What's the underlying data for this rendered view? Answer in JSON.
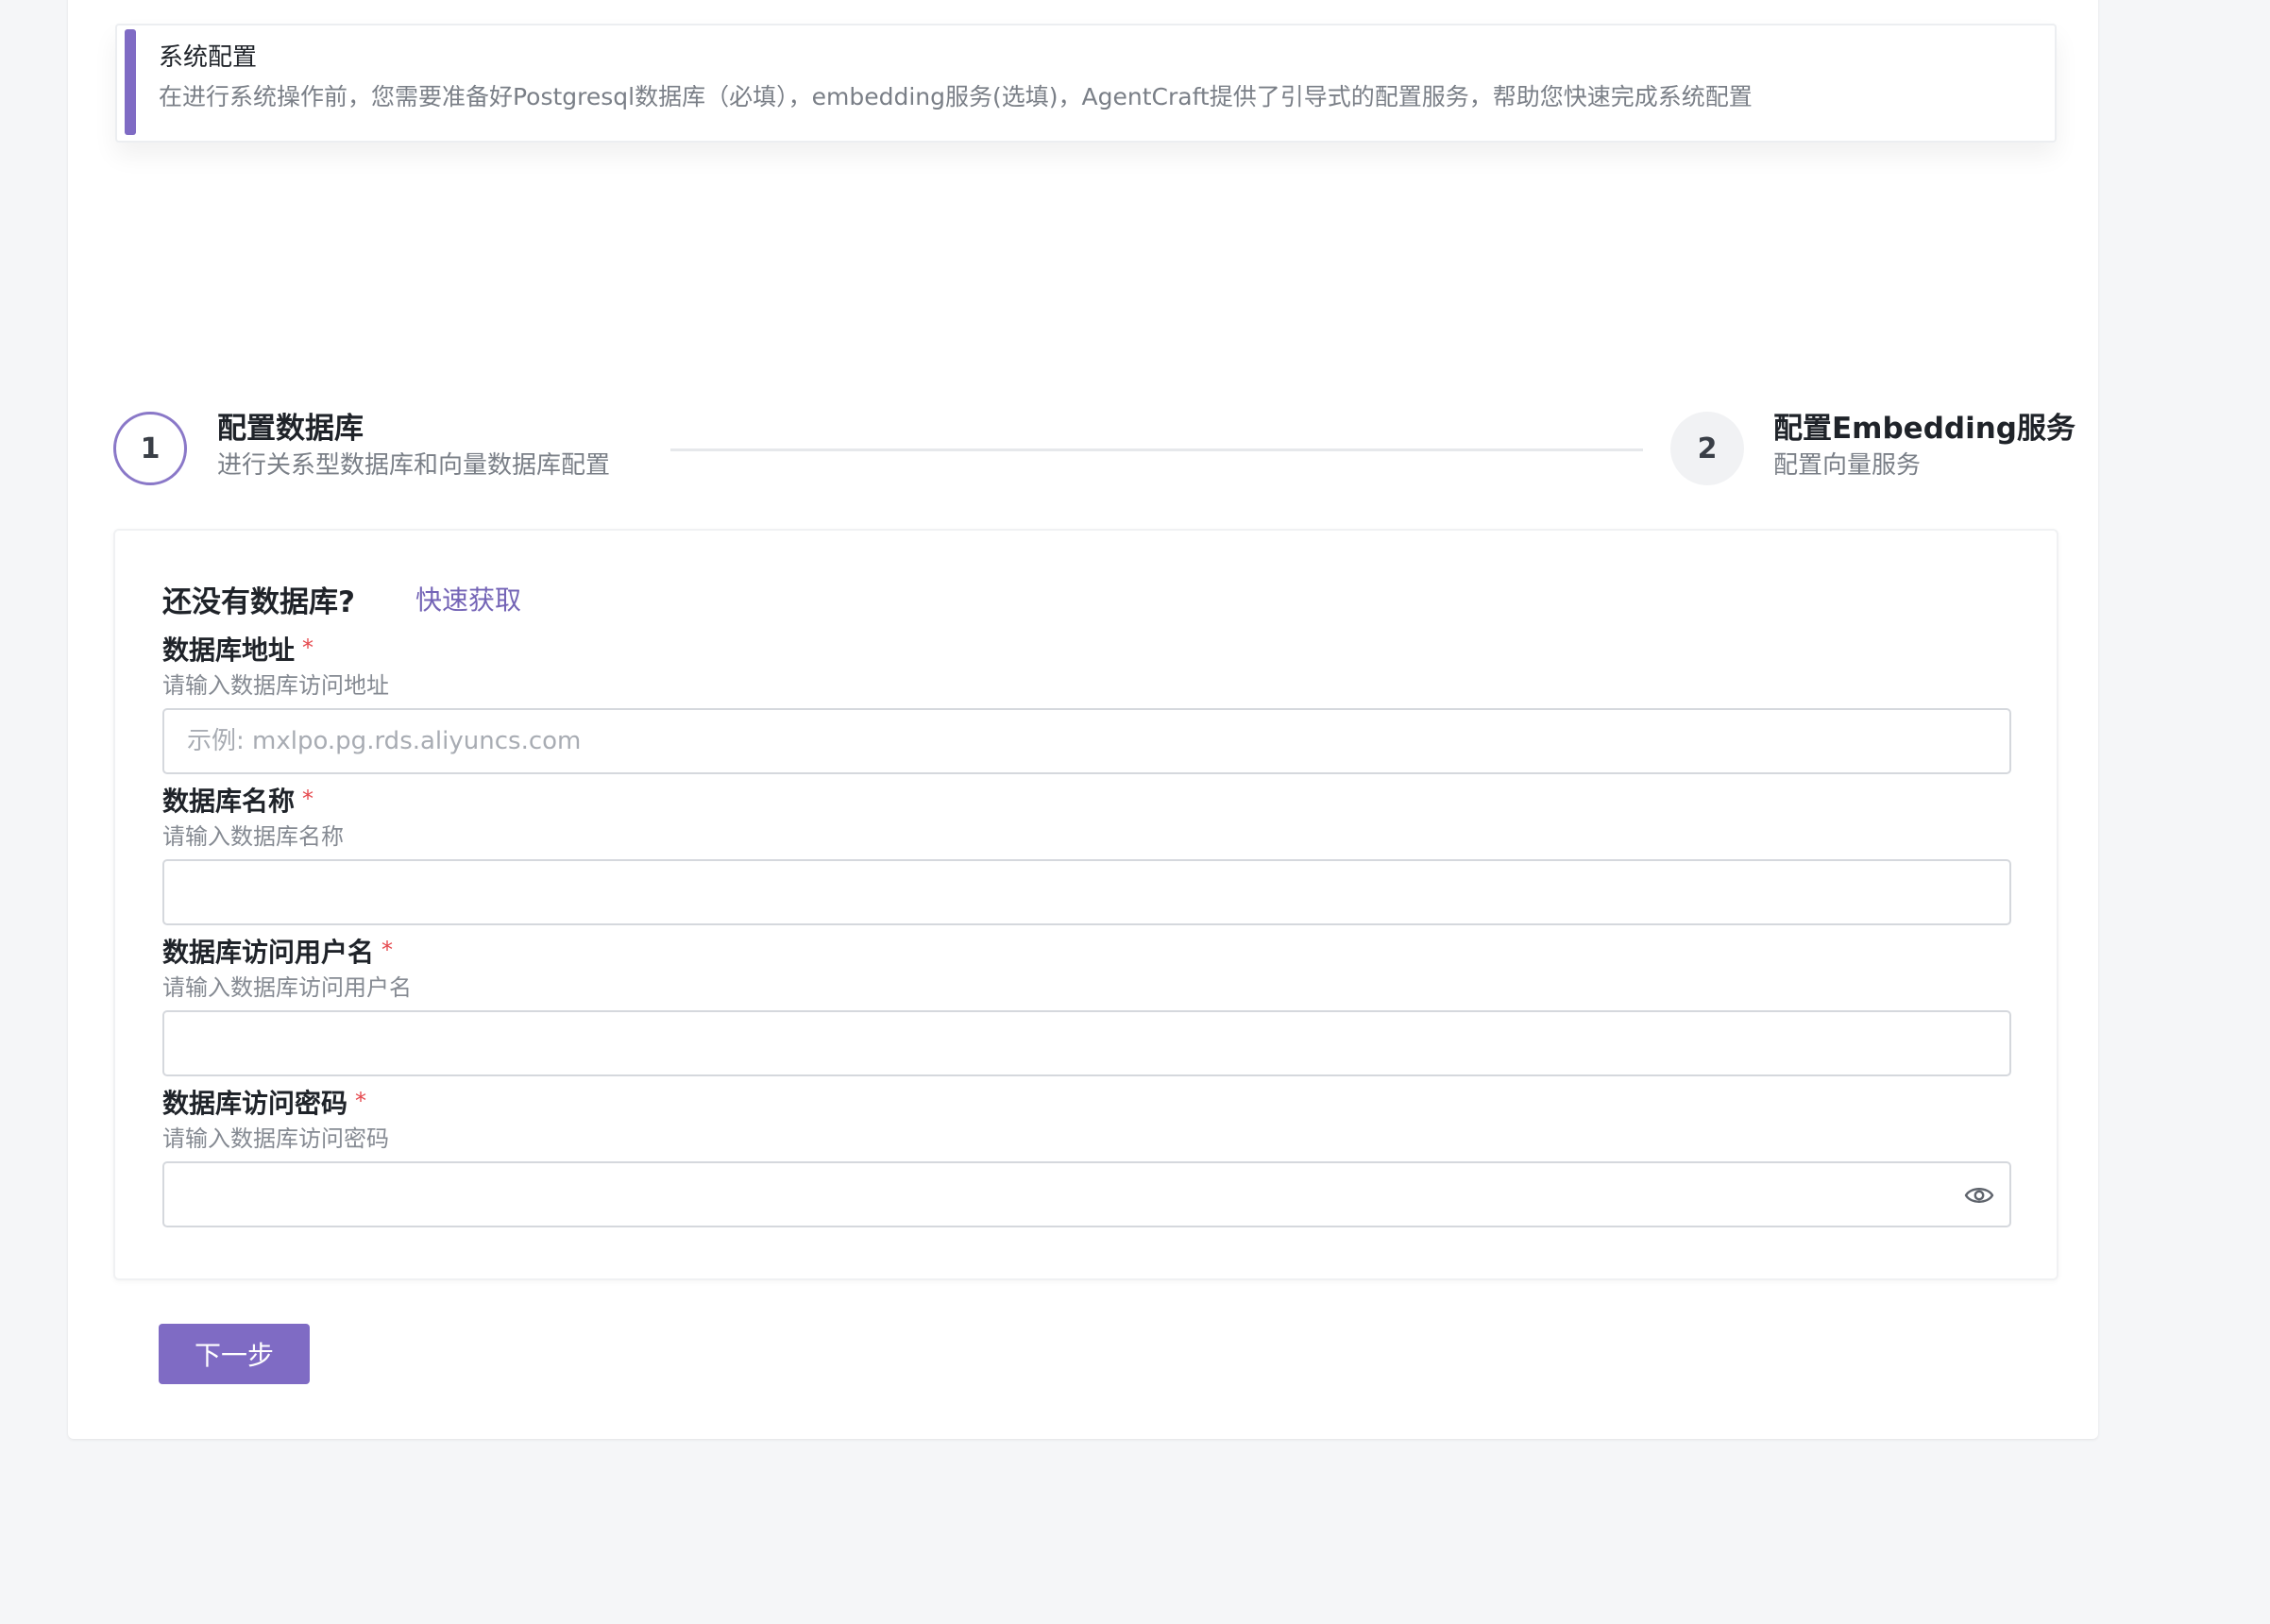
{
  "notice": {
    "title": "系统配置",
    "description": "在进行系统操作前，您需要准备好Postgresql数据库（必填），embedding服务(选填)，AgentCraft提供了引导式的配置服务，帮助您快速完成系统配置"
  },
  "steps": [
    {
      "number": "1",
      "title": "配置数据库",
      "description": "进行关系型数据库和向量数据库配置",
      "status": "active"
    },
    {
      "number": "2",
      "title": "配置Embedding服务",
      "description": "配置向量服务",
      "status": "pending"
    }
  ],
  "form": {
    "heading": "还没有数据库?",
    "quick_link": "快速获取",
    "required_mark": "*",
    "fields": [
      {
        "label": "数据库地址",
        "help": "请输入数据库访问地址",
        "placeholder": "示例: mxlpo.pg.rds.aliyuncs.com",
        "value": ""
      },
      {
        "label": "数据库名称",
        "help": "请输入数据库名称",
        "placeholder": "",
        "value": ""
      },
      {
        "label": "数据库访问用户名",
        "help": "请输入数据库访问用户名",
        "placeholder": "",
        "value": ""
      },
      {
        "label": "数据库访问密码",
        "help": "请输入数据库访问密码",
        "placeholder": "",
        "value": "",
        "icon": "eye-icon"
      }
    ]
  },
  "actions": {
    "next_label": "下一步"
  },
  "colors": {
    "accent": "#7f6bc4",
    "required": "#e5484d",
    "link": "#7464b6"
  }
}
